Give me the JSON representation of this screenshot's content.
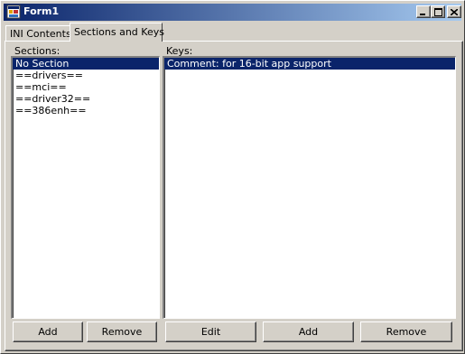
{
  "window": {
    "title": "Form1",
    "controls": {
      "minimize": "minimize-icon",
      "maximize": "maximize-icon",
      "close": "close-icon"
    }
  },
  "tabs": [
    {
      "label": "INI Contents",
      "active": false
    },
    {
      "label": "Sections and Keys",
      "active": true
    }
  ],
  "sections_panel": {
    "label": "Sections:",
    "items": [
      "No Section",
      "==drivers==",
      "==mci==",
      "==driver32==",
      "==386enh=="
    ],
    "selected_index": 0,
    "add_label": "Add",
    "remove_label": "Remove"
  },
  "keys_panel": {
    "label": "Keys:",
    "items": [
      "Comment:  for 16-bit app support"
    ],
    "selected_index": 0,
    "edit_label": "Edit",
    "add_label": "Add",
    "remove_label": "Remove"
  },
  "colors": {
    "titlebar_start": "#0a246a",
    "titlebar_end": "#a6caf0",
    "selection": "#0a246a",
    "face": "#d4d0c8"
  }
}
